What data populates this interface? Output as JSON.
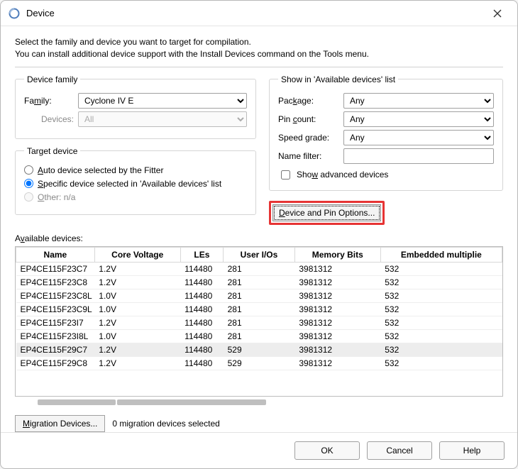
{
  "window": {
    "title": "Device"
  },
  "intro": {
    "line1": "Select the family and device you want to target for compilation.",
    "line2": "You can install additional device support with the Install Devices command on the Tools menu."
  },
  "device_family": {
    "legend": "Device family",
    "family_label": "Family:",
    "family_value": "Cyclone IV E",
    "devices_label": "Devices:",
    "devices_value": "All"
  },
  "target_device": {
    "legend": "Target device",
    "auto_label": "Auto device selected by the Fitter",
    "specific_label": "Specific device selected in 'Available devices' list",
    "other_label": "Other:",
    "other_value": "n/a",
    "selected": "specific"
  },
  "show_in": {
    "legend": "Show in 'Available devices' list",
    "package_label": "Package:",
    "package_value": "Any",
    "pin_label": "Pin count:",
    "pin_value": "Any",
    "speed_label": "Speed grade:",
    "speed_value": "Any",
    "namefilter_label": "Name filter:",
    "namefilter_value": "",
    "adv_label": "Show advanced devices"
  },
  "pin_options_btn": "Device and Pin Options...",
  "available_label": "Available devices:",
  "table": {
    "headers": [
      "Name",
      "Core Voltage",
      "LEs",
      "User I/Os",
      "Memory Bits",
      "Embedded multiplie"
    ],
    "rows": [
      {
        "name": "EP4CE115F23C7",
        "cv": "1.2V",
        "le": "114480",
        "io": "281",
        "mb": "3981312",
        "em": "532"
      },
      {
        "name": "EP4CE115F23C8",
        "cv": "1.2V",
        "le": "114480",
        "io": "281",
        "mb": "3981312",
        "em": "532"
      },
      {
        "name": "EP4CE115F23C8L",
        "cv": "1.0V",
        "le": "114480",
        "io": "281",
        "mb": "3981312",
        "em": "532"
      },
      {
        "name": "EP4CE115F23C9L",
        "cv": "1.0V",
        "le": "114480",
        "io": "281",
        "mb": "3981312",
        "em": "532"
      },
      {
        "name": "EP4CE115F23I7",
        "cv": "1.2V",
        "le": "114480",
        "io": "281",
        "mb": "3981312",
        "em": "532"
      },
      {
        "name": "EP4CE115F23I8L",
        "cv": "1.0V",
        "le": "114480",
        "io": "281",
        "mb": "3981312",
        "em": "532"
      },
      {
        "name": "EP4CE115F29C7",
        "cv": "1.2V",
        "le": "114480",
        "io": "529",
        "mb": "3981312",
        "em": "532",
        "sel": true
      },
      {
        "name": "EP4CE115F29C8",
        "cv": "1.2V",
        "le": "114480",
        "io": "529",
        "mb": "3981312",
        "em": "532"
      }
    ]
  },
  "migration_btn": "Migration Devices...",
  "migration_status": "0 migration devices selected",
  "footer": {
    "ok": "OK",
    "cancel": "Cancel",
    "help": "Help"
  }
}
